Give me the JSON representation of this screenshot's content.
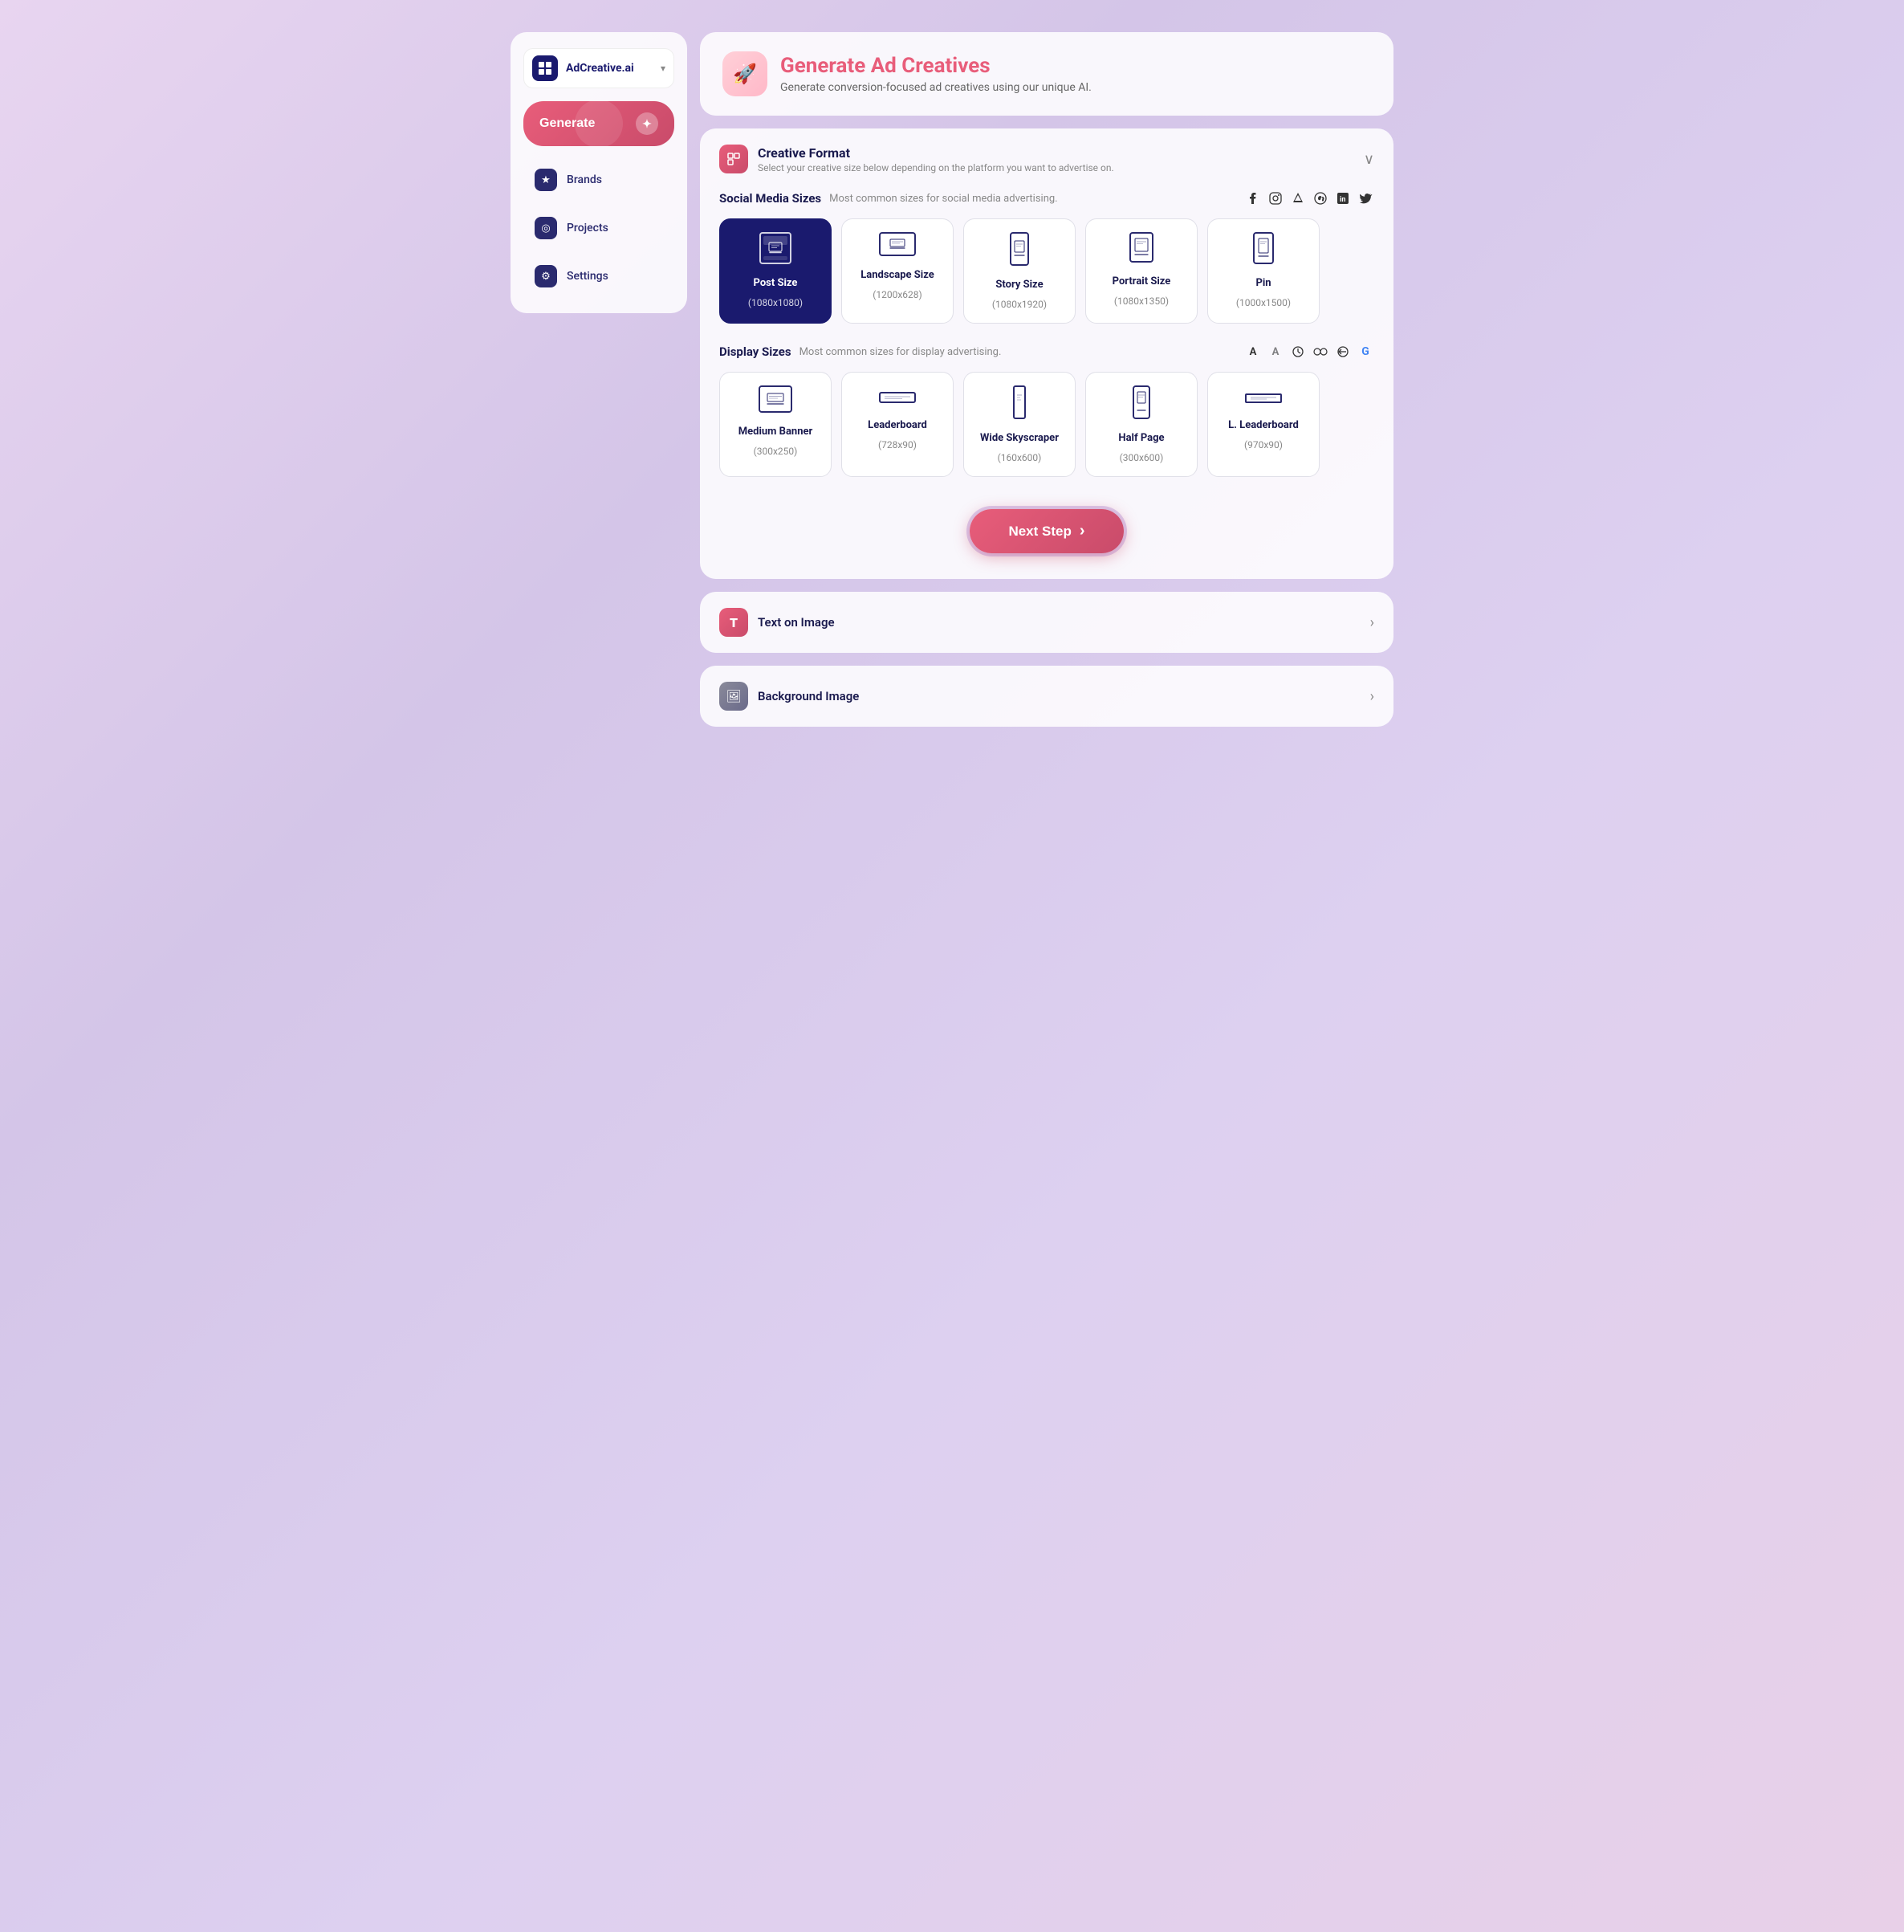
{
  "app": {
    "logo_text": "AdCreative.ai",
    "logo_chevron": "▾"
  },
  "sidebar": {
    "generate_label": "Generate",
    "nav_items": [
      {
        "id": "brands",
        "label": "Brands",
        "icon": "★"
      },
      {
        "id": "projects",
        "label": "Projects",
        "icon": "◎"
      },
      {
        "id": "settings",
        "label": "Settings",
        "icon": "⚙"
      }
    ]
  },
  "header": {
    "title": "Generate Ad Creatives",
    "subtitle": "Generate conversion-focused ad creatives using our unique AI.",
    "icon": "🚀"
  },
  "creative_format": {
    "section_title": "Creative Format",
    "section_subtitle": "Select your creative size below depending on the platform you want to advertise on.",
    "social_media": {
      "title": "Social Media Sizes",
      "subtitle": "Most common sizes for social media advertising.",
      "platform_icons": [
        "f",
        "◉",
        "▲",
        "⊙",
        "in",
        "🐦"
      ],
      "sizes": [
        {
          "id": "post",
          "name": "Post Size",
          "dimensions": "(1080x1080)",
          "selected": true,
          "shape": "square"
        },
        {
          "id": "landscape",
          "name": "Landscape Size",
          "dimensions": "(1200x628)",
          "selected": false,
          "shape": "landscape"
        },
        {
          "id": "story",
          "name": "Story Size",
          "dimensions": "(1080x1920)",
          "selected": false,
          "shape": "story"
        },
        {
          "id": "portrait",
          "name": "Portrait Size",
          "dimensions": "(1080x1350)",
          "selected": false,
          "shape": "portrait"
        },
        {
          "id": "pin",
          "name": "Pin",
          "dimensions": "(1000x1500)",
          "selected": false,
          "shape": "pin"
        }
      ]
    },
    "display": {
      "title": "Display Sizes",
      "subtitle": "Most common sizes for display advertising.",
      "platform_icons": [
        "A",
        "A",
        "◌",
        "◉◉",
        "⊘",
        "G"
      ],
      "sizes": [
        {
          "id": "medium-banner",
          "name": "Medium Banner",
          "dimensions": "(300x250)",
          "selected": false,
          "shape": "medium"
        },
        {
          "id": "leaderboard",
          "name": "Leaderboard",
          "dimensions": "(728x90)",
          "selected": false,
          "shape": "leaderboard"
        },
        {
          "id": "wide-skyscraper",
          "name": "Wide Skyscraper",
          "dimensions": "(160x600)",
          "selected": false,
          "shape": "skyscraper"
        },
        {
          "id": "half-page",
          "name": "Half Page",
          "dimensions": "(300x600)",
          "selected": false,
          "shape": "halfpage"
        },
        {
          "id": "l-leaderboard",
          "name": "L. Leaderboard",
          "dimensions": "(970x90)",
          "selected": false,
          "shape": "lleaderboard"
        }
      ]
    },
    "next_step_label": "Next Step",
    "next_step_arrow": "›"
  },
  "text_on_image": {
    "section_title": "Text on Image",
    "icon": "T"
  },
  "background_image": {
    "section_title": "Background Image",
    "icon": "🖼"
  }
}
